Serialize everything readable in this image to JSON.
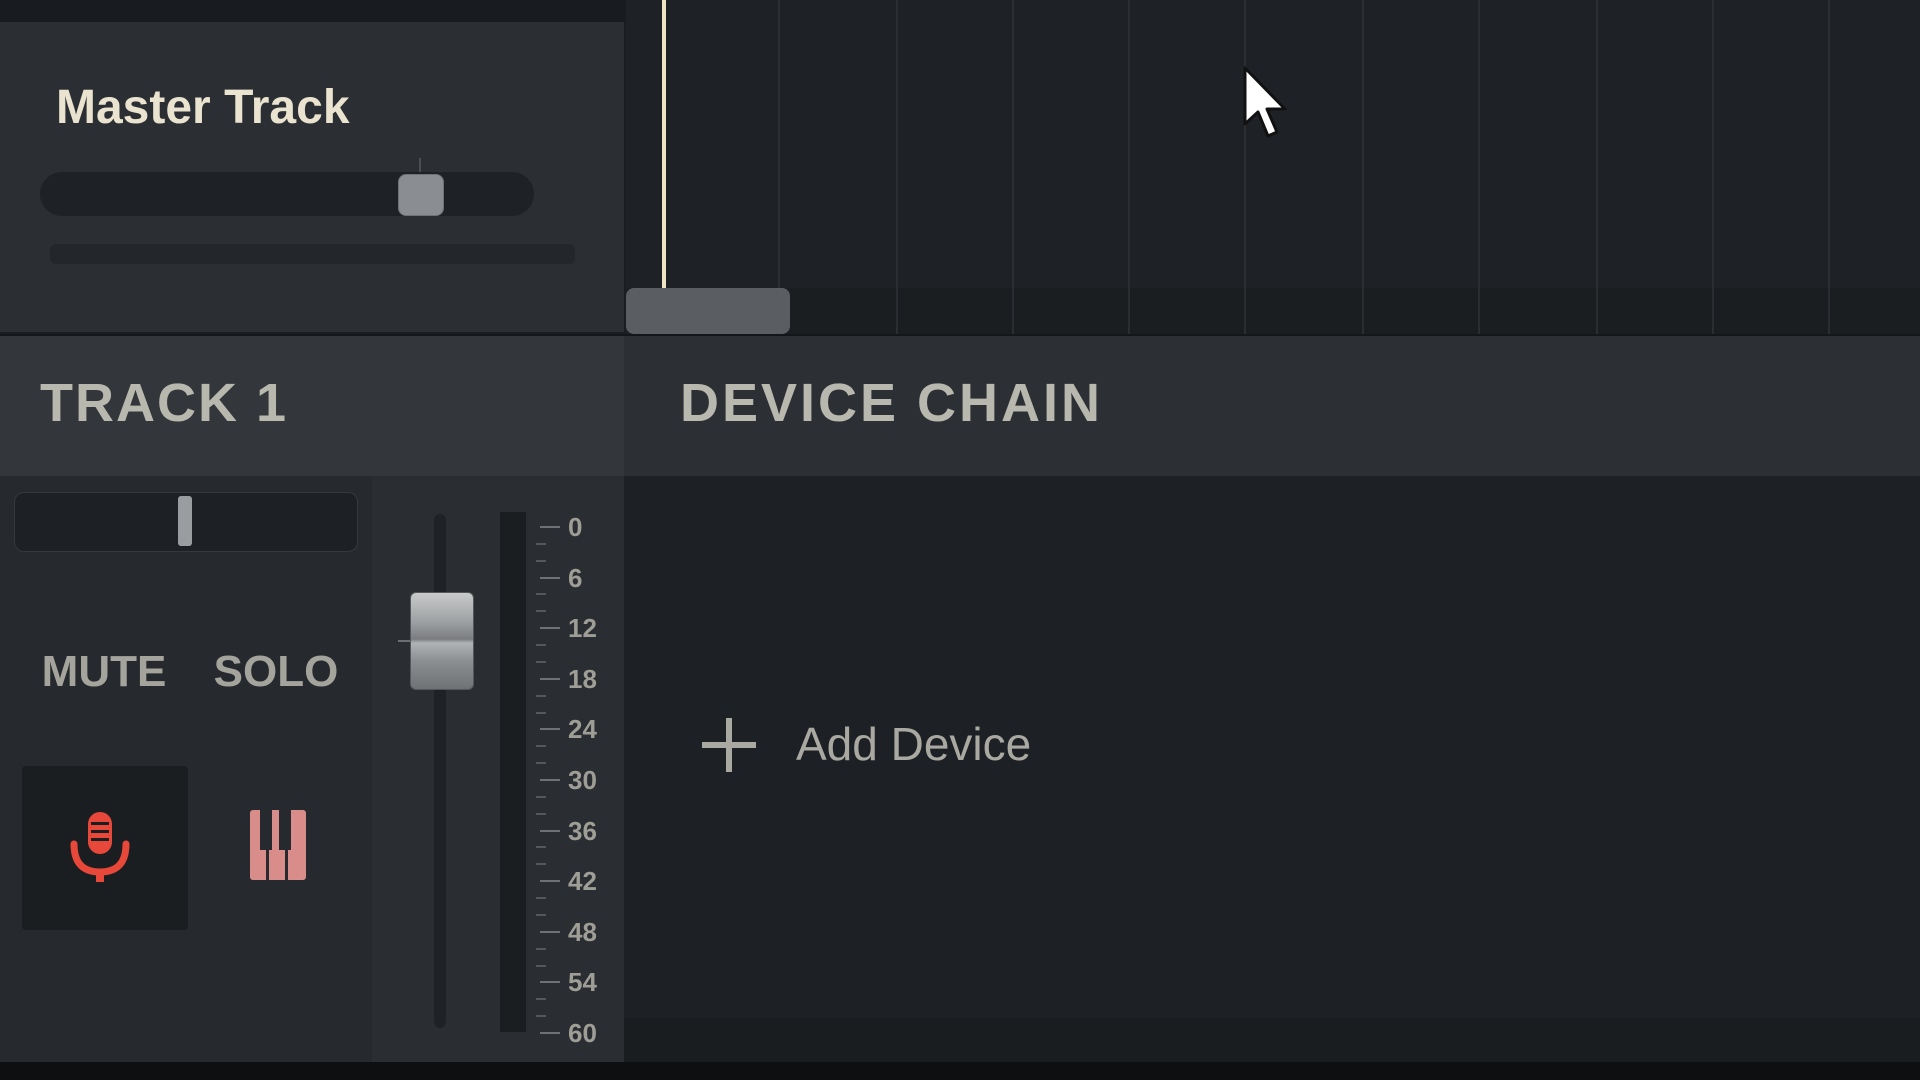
{
  "master": {
    "title": "Master Track"
  },
  "track": {
    "name": "TRACK 1",
    "mute_label": "MUTE",
    "solo_label": "SOLO"
  },
  "device_chain": {
    "title": "DEVICE CHAIN",
    "add_device_label": "Add Device"
  },
  "meter_scale": [
    "0",
    "6",
    "12",
    "18",
    "24",
    "30",
    "36",
    "42",
    "48",
    "54",
    "60"
  ],
  "icons": {
    "record": "microphone-icon",
    "instrument": "piano-keys-icon",
    "add": "plus-icon",
    "cursor": "mouse-pointer-icon"
  },
  "colors": {
    "record_accent": "#e8483a",
    "instrument_accent": "#d98d8b",
    "playhead": "#efe5c2"
  }
}
